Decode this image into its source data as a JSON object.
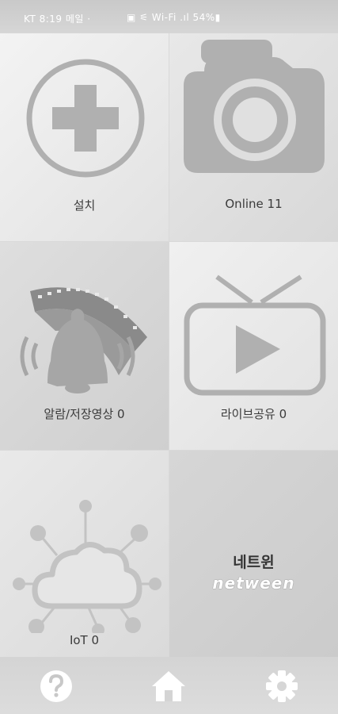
{
  "status_bar": {
    "left": "KT 8:19 메일 ·",
    "right": "▣ ⚟ Wi-Fi .ıl 54%▮"
  },
  "tiles": [
    {
      "label": "설치",
      "icon": "plus-circle-icon"
    },
    {
      "label": "Online 11",
      "icon": "camera-icon"
    },
    {
      "label": "알람/저장영상 0",
      "icon": "bell-film-icon"
    },
    {
      "label": "라이브공유 0",
      "icon": "tv-play-icon"
    },
    {
      "label": "IoT 0",
      "icon": "cloud-network-icon"
    },
    {
      "logo_korean": "네트윈",
      "logo_english": "netween"
    }
  ],
  "bottom_nav": [
    {
      "name": "help",
      "icon": "question-circle-icon"
    },
    {
      "name": "home",
      "icon": "home-icon"
    },
    {
      "name": "settings",
      "icon": "gear-icon"
    }
  ]
}
